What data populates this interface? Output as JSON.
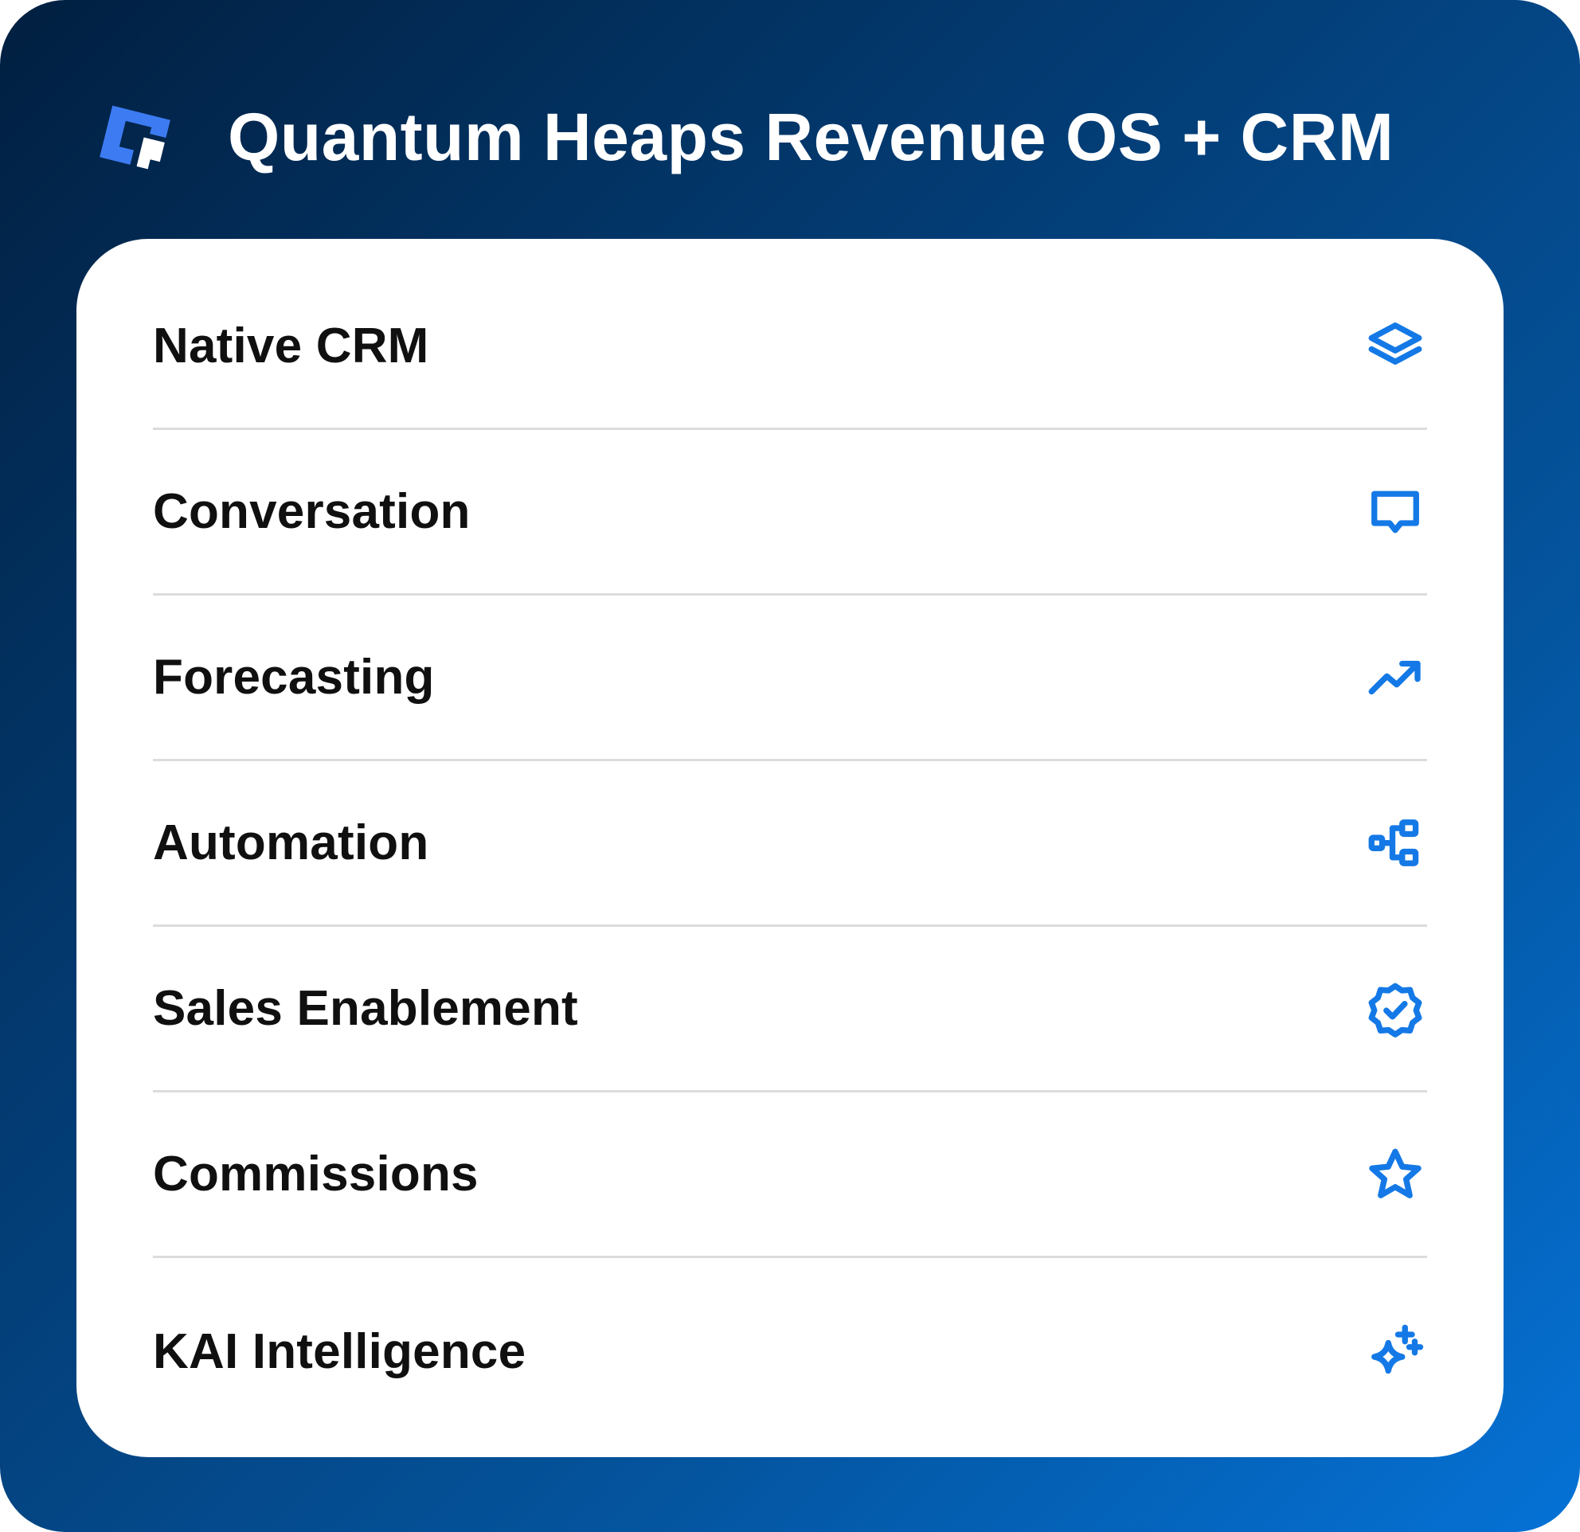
{
  "header": {
    "title": "Quantum Heaps Revenue OS + CRM",
    "logo_icon": "quantum-heaps-logo-icon"
  },
  "colors": {
    "background_gradient_start": "#011f40",
    "background_gradient_end": "#0572d6",
    "card_background": "#ffffff",
    "icon_accent": "#1479e6",
    "logo_accent": "#3d7bf2",
    "divider": "#dcdcdc",
    "label_text": "#101010"
  },
  "features": [
    {
      "label": "Native CRM",
      "icon": "layers-icon"
    },
    {
      "label": "Conversation",
      "icon": "chat-bubble-icon"
    },
    {
      "label": "Forecasting",
      "icon": "trending-up-icon"
    },
    {
      "label": "Automation",
      "icon": "workflow-icon"
    },
    {
      "label": "Sales Enablement",
      "icon": "verified-badge-icon"
    },
    {
      "label": "Commissions",
      "icon": "star-icon"
    },
    {
      "label": "KAI Intelligence",
      "icon": "sparkles-icon"
    }
  ]
}
